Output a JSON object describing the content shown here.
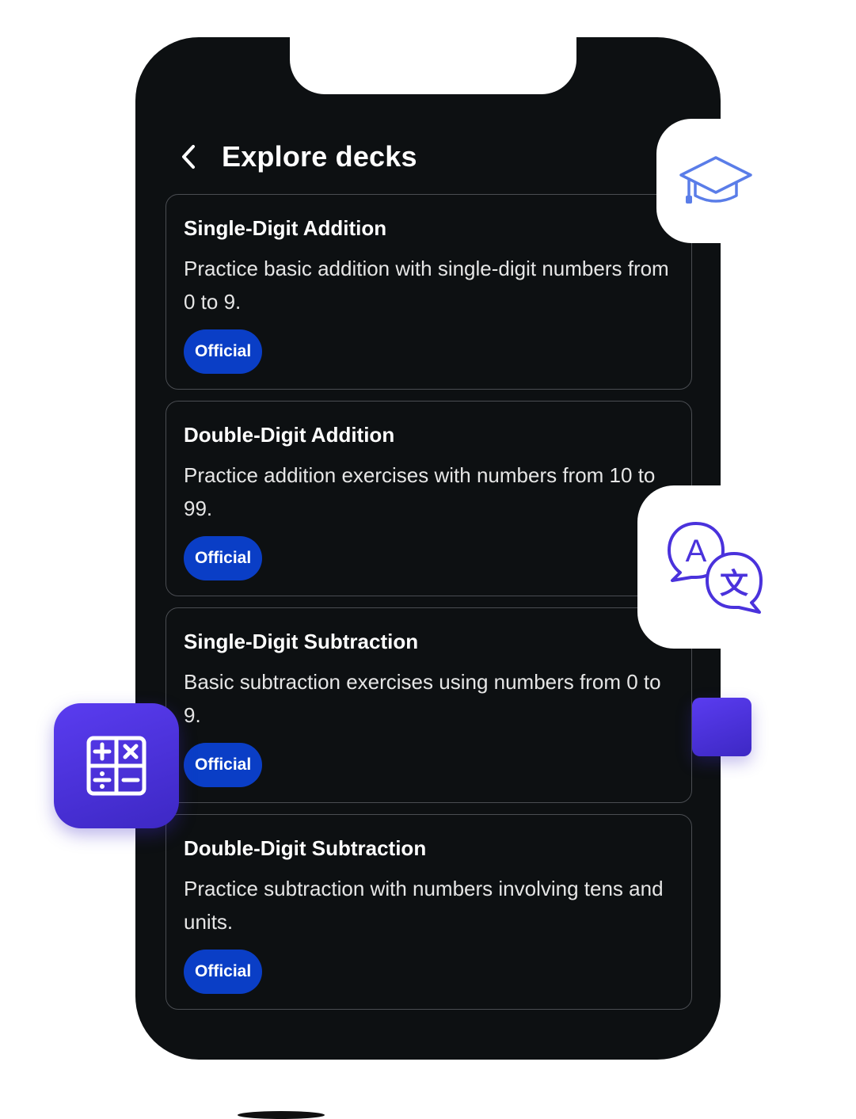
{
  "header": {
    "title": "Explore decks"
  },
  "decks": [
    {
      "title": "Single-Digit Addition",
      "description": "Practice basic addition with single-digit numbers from 0 to 9.",
      "badge": "Official"
    },
    {
      "title": "Double-Digit Addition",
      "description": "Practice addition exercises with numbers from 10 to 99.",
      "badge": "Official"
    },
    {
      "title": "Single-Digit Subtraction",
      "description": "Basic subtraction exercises using numbers from 0 to 9.",
      "badge": "Official"
    },
    {
      "title": "Double-Digit Subtraction",
      "description": "Practice subtraction with numbers involving tens and units.",
      "badge": "Official"
    }
  ],
  "decorations": {
    "icons": [
      "graduation-cap-icon",
      "translate-icon",
      "calculator-icon"
    ]
  },
  "colors": {
    "screen_background": "#0d1012",
    "badge_background": "#0a3ec6",
    "accent_purple": "#4a32dc",
    "icon_blue": "#5a7de8"
  }
}
